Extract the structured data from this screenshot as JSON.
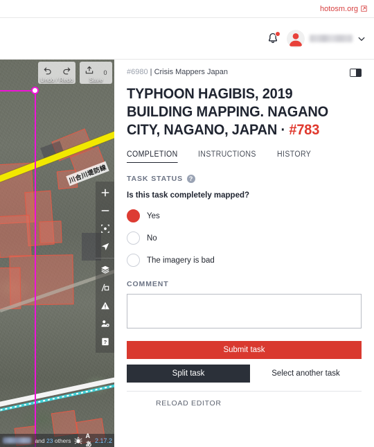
{
  "topbar": {
    "link_label": "hotosm.org",
    "link_icon": "external-link-icon"
  },
  "header": {
    "bell_icon": "notification-bell-icon",
    "avatar_icon": "user-avatar-icon",
    "username": "",
    "chevron_icon": "chevron-down-icon"
  },
  "editor": {
    "undo_icon": "undo-arrow-icon",
    "redo_icon": "redo-arrow-icon",
    "save_icon": "save-upload-icon",
    "save_count": "0",
    "undo_redo_label": "Undo / Redo",
    "save_label": "Save",
    "sidebar_icons": [
      "zoom-in-icon",
      "zoom-out-icon",
      "geolocate-icon",
      "navigation-arrow-icon",
      "background-layers-icon",
      "map-data-icon",
      "issues-warning-icon",
      "preferences-user-icon",
      "help-question-icon"
    ],
    "road_label": "川合川堤防線",
    "status_user": "",
    "status_others_prefix": "and",
    "status_others_count": "23",
    "status_others_suffix": "others",
    "bug_icon": "bug-report-icon",
    "language_label": "Aあ",
    "version": "2.17.2"
  },
  "task": {
    "project_id": "#6980",
    "separator": "|",
    "organisation": "Crisis Mappers Japan",
    "layout_toggle_icon": "layout-toggle-icon",
    "title_main": "TYPHOON HAGIBIS, 2019 BUILDING MAPPING. NAGANO CITY, NAGANO, JAPAN · ",
    "title_number": "#783",
    "tabs": [
      {
        "label": "COMPLETION",
        "active": true
      },
      {
        "label": "INSTRUCTIONS",
        "active": false
      },
      {
        "label": "HISTORY",
        "active": false
      }
    ],
    "status_section_label": "TASK STATUS",
    "help_icon": "help-question-icon",
    "help_glyph": "?",
    "question": "Is this task completely mapped?",
    "options": [
      {
        "label": "Yes",
        "selected": true
      },
      {
        "label": "No",
        "selected": false
      },
      {
        "label": "The imagery is bad",
        "selected": false
      }
    ],
    "comment_label": "COMMENT",
    "comment_value": "",
    "comment_placeholder": "",
    "submit_label": "Submit task",
    "split_label": "Split task",
    "select_another_label": "Select another task",
    "reload_label": "RELOAD EDITOR"
  },
  "colors": {
    "accent_red": "#d9392f",
    "dark": "#2b3039",
    "link_red": "#d73f3f",
    "title_number_red": "#e0392e",
    "muted": "#6b7384"
  }
}
